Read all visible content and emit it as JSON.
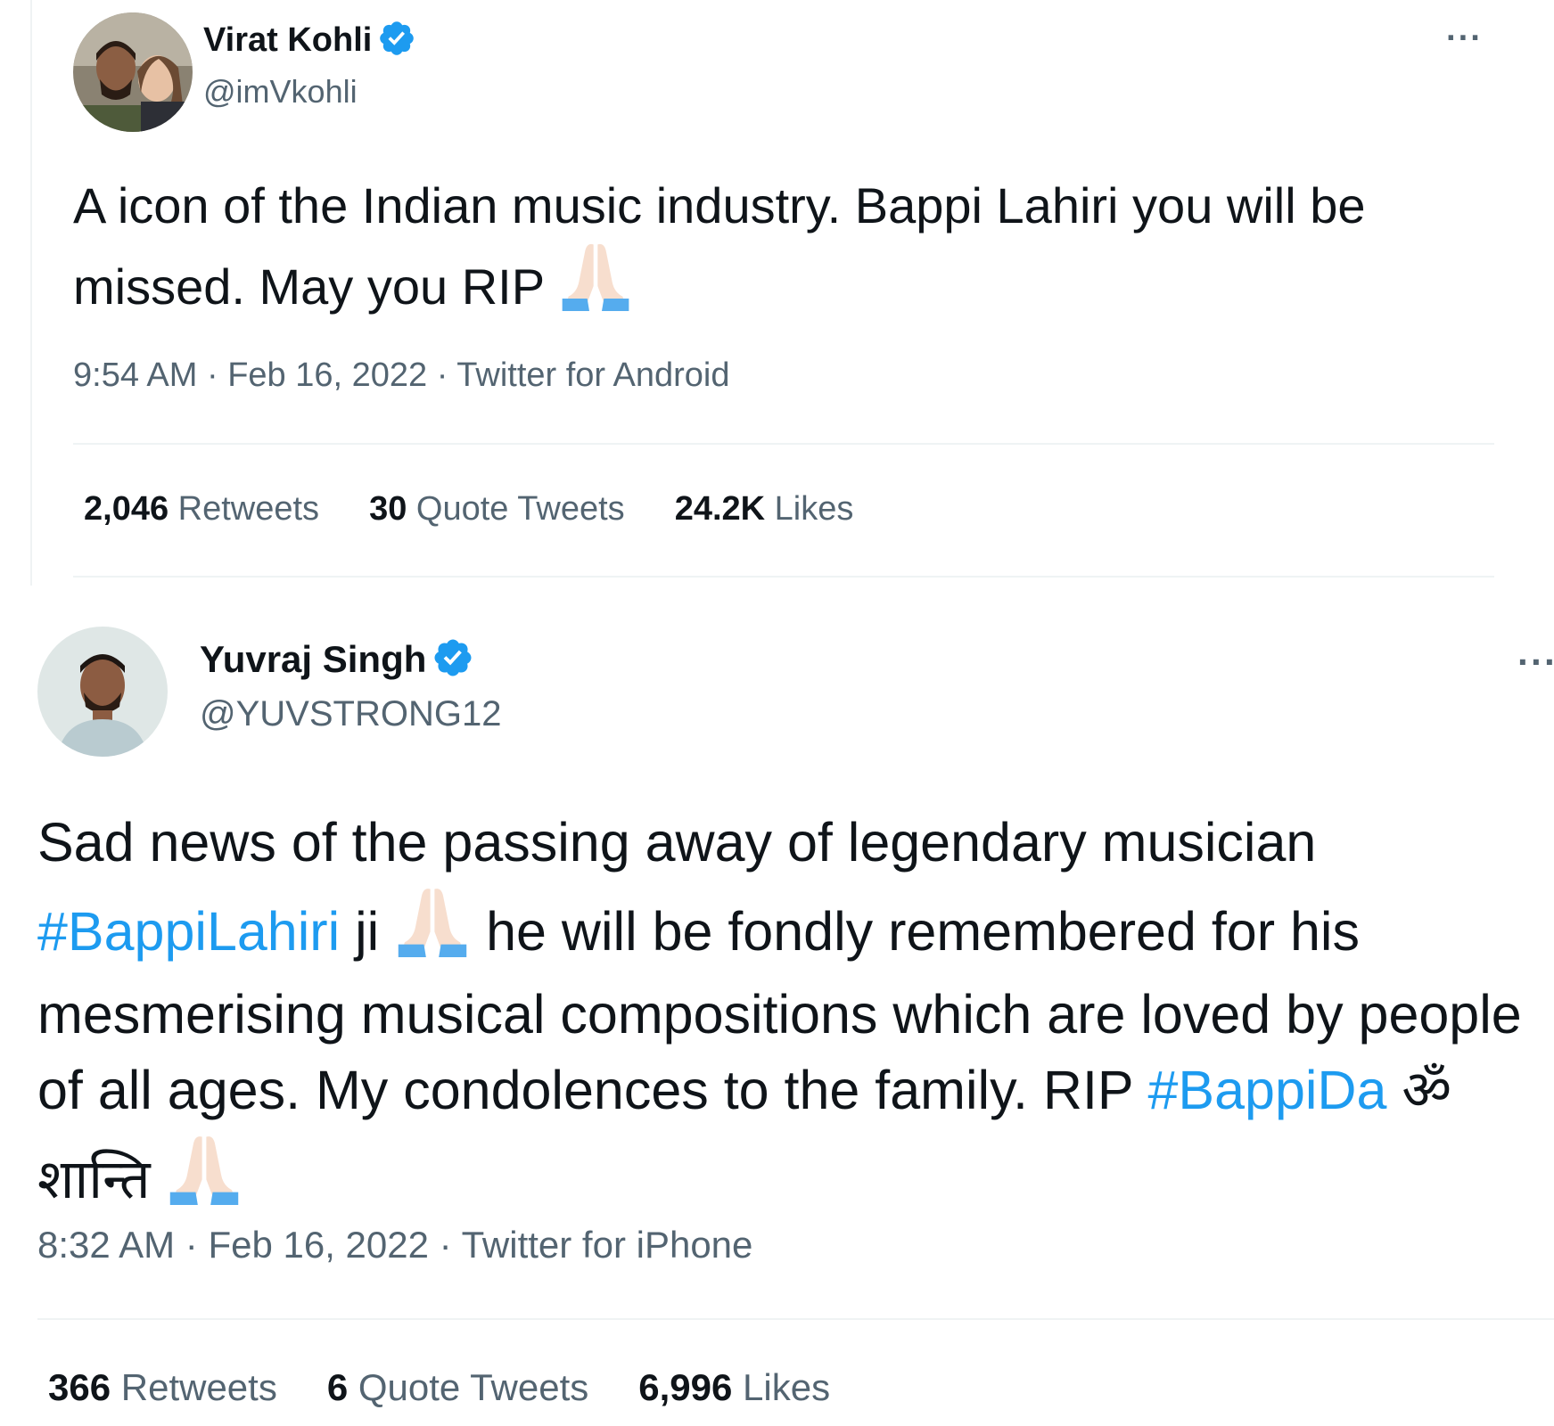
{
  "tweets": [
    {
      "name": "Virat Kohli",
      "handle": "@imVkohli",
      "more": "···",
      "text_1": "A icon of the Indian music industry. Bappi Lahiri you will be missed. May you RIP",
      "time": "9:54 AM",
      "date": "Feb 16, 2022",
      "source": "Twitter for Android",
      "stats": [
        {
          "value": "2,046",
          "label": "Retweets"
        },
        {
          "value": "30",
          "label": "Quote Tweets"
        },
        {
          "value": "24.2K",
          "label": "Likes"
        }
      ]
    },
    {
      "name": "Yuvraj Singh",
      "handle": "@YUVSTRONG12",
      "more": "···",
      "text_a": "Sad news of the passing away of legendary musician",
      "hashtag_1": "#BappiLahiri",
      "text_b": "ji",
      "text_c": "he will be fondly remembered for his mesmerising musical compositions which are loved by people of all ages. My condolences to the family. RIP",
      "hashtag_2": "#BappiDa",
      "text_d": "ॐ शान्ति",
      "time": "8:32 AM",
      "date": "Feb 16, 2022",
      "source": "Twitter for iPhone",
      "stats": [
        {
          "value": "366",
          "label": "Retweets"
        },
        {
          "value": "6",
          "label": "Quote Tweets"
        },
        {
          "value": "6,996",
          "label": "Likes"
        }
      ]
    }
  ],
  "separator": "·",
  "colors": {
    "link": "#1d9bf0",
    "secondary": "#536471",
    "verified": "#1d9bf0"
  },
  "icons": [
    "verified-badge-icon",
    "more-options-icon",
    "folded-hands-emoji-icon"
  ]
}
